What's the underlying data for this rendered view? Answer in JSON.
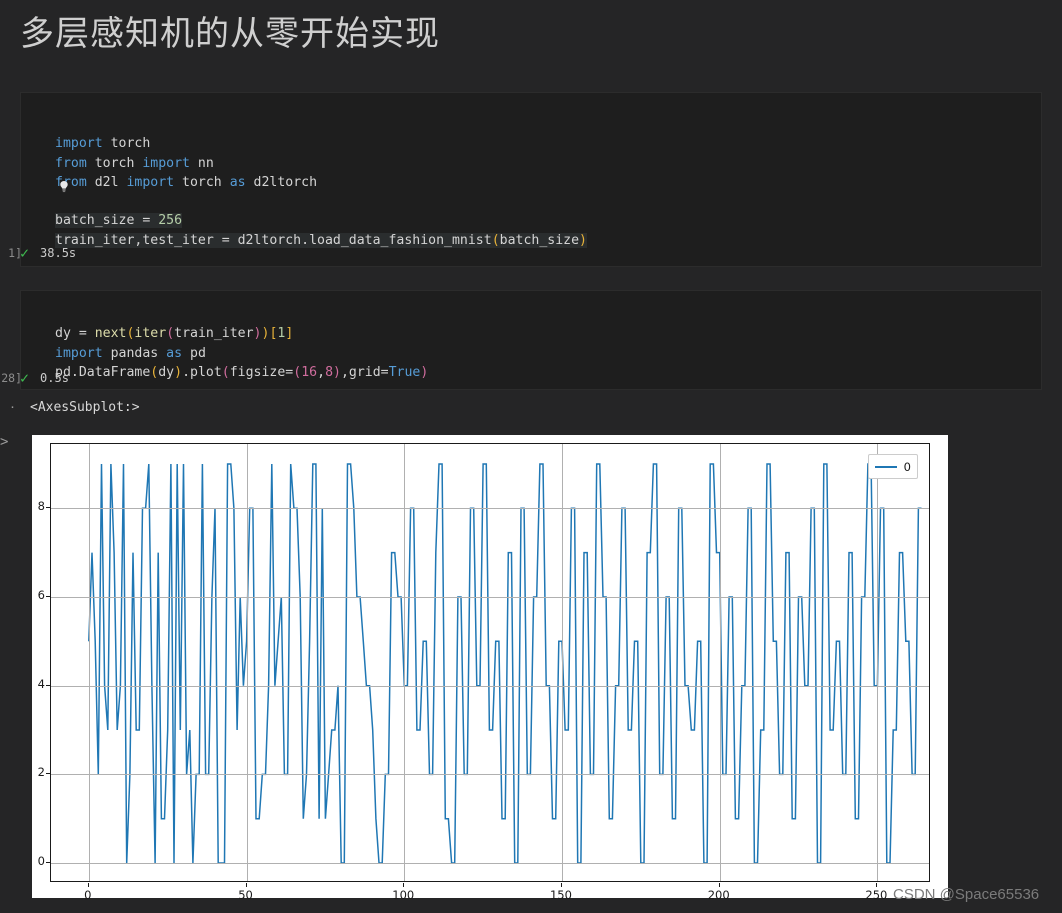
{
  "notebook": {
    "title": "多层感知机的从零开始实现"
  },
  "cells": [
    {
      "exec_count": "1]",
      "status_icon": "check-icon",
      "duration": "38.5s",
      "code_lines": [
        "import torch",
        "from torch import nn",
        "from d2l import torch as d2ltorch",
        "",
        "batch_size = 256",
        "train_iter,test_iter = d2ltorch.load_data_fashion_mnist(batch_size)"
      ],
      "hint_icon": "lightbulb-icon"
    },
    {
      "exec_count": "28]",
      "status_icon": "check-icon",
      "duration": "0.5s",
      "code_lines": [
        "dy = next(iter(train_iter))[1]",
        "import pandas as pd",
        "pd.DataFrame(dy).plot(figsize=(16,8),grid=True)"
      ]
    }
  ],
  "output": {
    "bullet": "·",
    "text": "<AxesSubplot:>",
    "chevron": ">"
  },
  "watermark": "CSDN @Space65536",
  "colors": {
    "line": "#1f77b4",
    "grid": "#b0b0b0",
    "page_bg": "#252526",
    "cell_bg": "#1e1e1e",
    "check": "#3fb950"
  },
  "chart_data": {
    "type": "line",
    "title": "",
    "xlabel": "",
    "ylabel": "",
    "grid": true,
    "legend": {
      "position": "upper right",
      "entries": [
        "0"
      ]
    },
    "xlim": [
      -12,
      267
    ],
    "ylim": [
      -0.45,
      9.45
    ],
    "xticks": [
      0,
      50,
      100,
      150,
      200,
      250
    ],
    "yticks": [
      0,
      2,
      4,
      6,
      8
    ],
    "series": [
      {
        "name": "0",
        "color": "#1f77b4",
        "x_start": 0,
        "values": [
          5,
          7,
          5,
          2,
          9,
          4,
          3,
          9,
          7,
          3,
          4,
          9,
          0,
          2,
          7,
          3,
          3,
          8,
          8,
          9,
          4,
          0,
          7,
          1,
          1,
          3,
          9,
          0,
          9,
          3,
          9,
          2,
          3,
          0,
          2,
          2,
          9,
          2,
          2,
          6,
          8,
          0,
          0,
          0,
          9,
          9,
          8,
          3,
          6,
          4,
          5,
          8,
          8,
          1,
          1,
          2,
          2,
          4,
          9,
          4,
          5,
          6,
          2,
          2,
          9,
          8,
          8,
          6,
          1,
          2,
          5,
          9,
          9,
          1,
          8,
          1,
          2,
          3,
          3,
          4,
          0,
          0,
          9,
          9,
          8,
          6,
          6,
          5,
          4,
          4,
          3,
          1,
          0,
          0,
          2,
          2,
          7,
          7,
          6,
          6,
          4,
          4,
          8,
          8,
          3,
          3,
          5,
          5,
          2,
          2,
          7,
          9,
          9,
          1,
          1,
          0,
          0,
          6,
          6,
          2,
          2,
          8,
          8,
          4,
          4,
          9,
          9,
          3,
          3,
          5,
          5,
          1,
          1,
          7,
          7,
          0,
          0,
          8,
          8,
          2,
          2,
          6,
          6,
          9,
          9,
          4,
          4,
          1,
          1,
          5,
          5,
          3,
          3,
          8,
          8,
          0,
          0,
          7,
          7,
          2,
          2,
          9,
          9,
          6,
          6,
          1,
          1,
          4,
          4,
          8,
          8,
          3,
          3,
          5,
          5,
          0,
          0,
          7,
          7,
          9,
          9,
          2,
          2,
          6,
          6,
          1,
          1,
          8,
          8,
          4,
          4,
          3,
          3,
          5,
          5,
          0,
          0,
          9,
          9,
          7,
          7,
          2,
          2,
          6,
          6,
          1,
          1,
          4,
          4,
          8,
          8,
          0,
          0,
          3,
          3,
          9,
          9,
          5,
          5,
          2,
          2,
          7,
          7,
          1,
          1,
          6,
          6,
          4,
          4,
          8,
          8,
          0,
          0,
          9,
          9,
          3,
          3,
          5,
          5,
          2,
          2,
          7,
          7,
          1,
          1,
          6,
          6,
          9,
          9,
          4,
          4,
          8,
          8,
          0,
          0,
          3,
          3,
          7,
          7,
          5,
          5,
          2,
          2,
          8,
          8
        ]
      }
    ]
  }
}
